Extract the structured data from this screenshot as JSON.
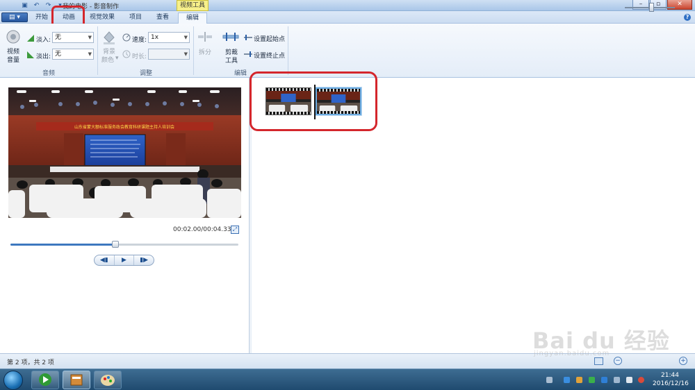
{
  "window": {
    "title": "我的电影 - 影音制作",
    "context_tab_title": "视频工具",
    "buttons": [
      "minimize",
      "maximize",
      "close"
    ]
  },
  "tabs": [
    {
      "label": "开始",
      "active": false
    },
    {
      "label": "动画",
      "active": false,
      "highlighted": true
    },
    {
      "label": "视觉效果",
      "active": false
    },
    {
      "label": "项目",
      "active": false
    },
    {
      "label": "查看",
      "active": false
    },
    {
      "label": "编辑",
      "active": true
    }
  ],
  "ribbon": {
    "audio": {
      "volume_label_1": "视频",
      "volume_label_2": "音量",
      "fade_in_label": "淡入:",
      "fade_in_value": "无",
      "fade_out_label": "淡出:",
      "fade_out_value": "无",
      "group_label": "音频"
    },
    "adjust": {
      "bg_color_label_1": "背景",
      "bg_color_label_2": "颜色",
      "speed_label": "速度:",
      "speed_value": "1x",
      "duration_label": "时长:",
      "duration_value": "",
      "group_label": "调整"
    },
    "edit": {
      "split_label": "拆分",
      "trim_label_1": "剪裁",
      "trim_label_2": "工具",
      "set_start_label": "设置起始点",
      "set_end_label": "设置终止点",
      "group_label": "编辑"
    }
  },
  "preview": {
    "banner_text": "山东省蒙大额标准服务政会教育科研课题主持人培训会",
    "time_current": "00:02.00",
    "time_total": "00:04.33",
    "time_display": "00:02.00/00:04.33",
    "progress_fraction": 0.46,
    "controls": [
      "previous-frame",
      "play",
      "next-frame"
    ]
  },
  "storyboard": {
    "clips": [
      {
        "selected": false
      },
      {
        "selected": true
      }
    ]
  },
  "status": {
    "text": "第 2 项，共 2 项",
    "zoom_fraction": 0.5
  },
  "taskbar": {
    "time": "21:44",
    "date": "2016/12/16"
  },
  "watermark": {
    "main": "Bai du 经验",
    "sub": "jingyan.baidu.com"
  }
}
